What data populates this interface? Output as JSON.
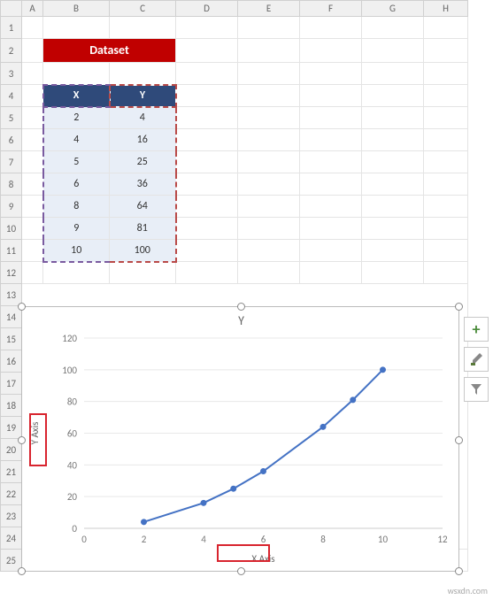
{
  "title": "Dataset",
  "columns": [
    "",
    "A",
    "B",
    "C",
    "D",
    "E",
    "F",
    "G",
    "H"
  ],
  "rows_count": 25,
  "table": {
    "headers": {
      "x": "X",
      "y": "Y"
    },
    "data": [
      [
        2,
        4
      ],
      [
        4,
        16
      ],
      [
        5,
        25
      ],
      [
        6,
        36
      ],
      [
        8,
        64
      ],
      [
        9,
        81
      ],
      [
        10,
        100
      ]
    ]
  },
  "chart_data": {
    "type": "line",
    "title": "Y",
    "xlabel": "X Axis",
    "ylabel": "Y Axis",
    "xlim": [
      0,
      12
    ],
    "ylim": [
      0,
      120
    ],
    "xticks": [
      0,
      2,
      4,
      6,
      8,
      10,
      12
    ],
    "yticks": [
      0,
      20,
      40,
      60,
      80,
      100,
      120
    ],
    "x": [
      2,
      4,
      5,
      6,
      8,
      9,
      10
    ],
    "y": [
      4,
      16,
      25,
      36,
      64,
      81,
      100
    ],
    "series_color": "#4472c4",
    "highlight_labels": [
      "X Axis",
      "Y Axis"
    ]
  },
  "toolbar": {
    "plus": "+",
    "brush": "brush-icon",
    "filter": "filter-icon"
  },
  "watermark": "wsxdn.com"
}
